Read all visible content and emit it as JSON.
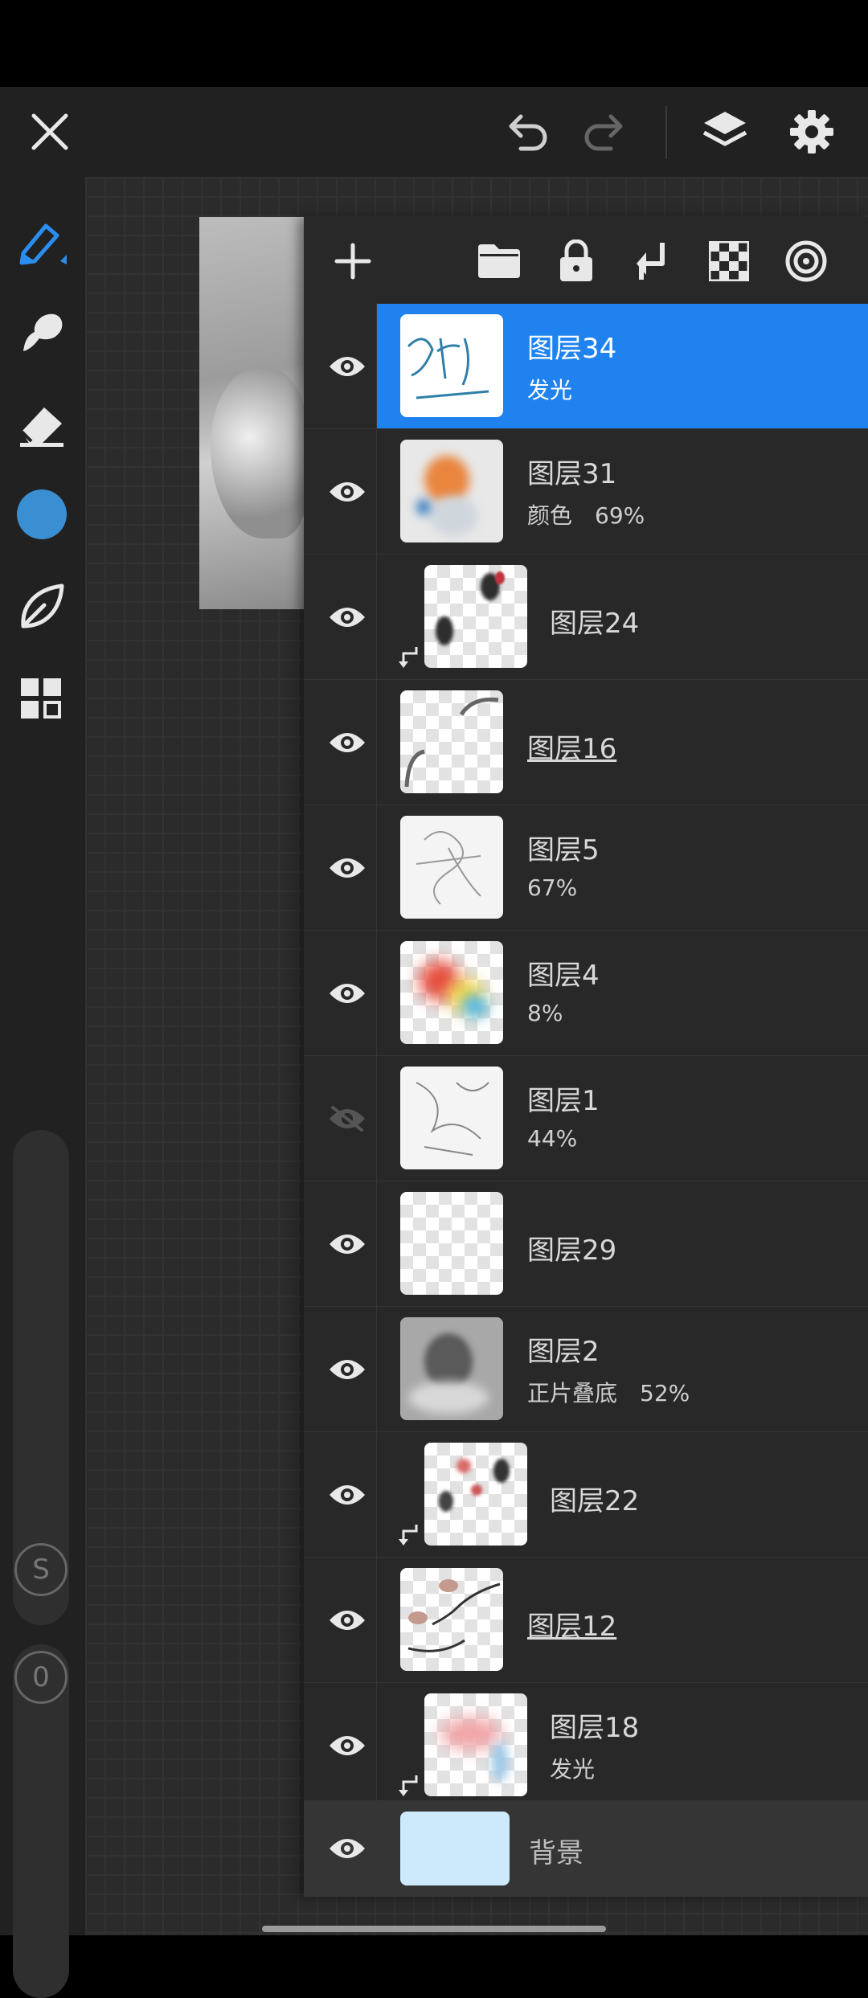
{
  "toolbar": {
    "icons": [
      "close-icon",
      "undo-icon",
      "redo-icon",
      "layers-icon",
      "settings-icon"
    ]
  },
  "tools": {
    "icons": [
      "pencil-icon",
      "smudge-icon",
      "eraser-icon",
      "color-icon",
      "leaf-icon",
      "grid-icon"
    ],
    "color": "#3a8fd3",
    "slider_top_label": "S",
    "slider_bottom_label": "0"
  },
  "layer_panel": {
    "toolbar_icons": [
      "add-layer-icon",
      "folder-icon",
      "lock-icon",
      "merge-down-icon",
      "alpha-checker-icon",
      "ring-target-icon"
    ],
    "accent": "#1f82ef",
    "layers": [
      {
        "name": "图层34",
        "sub": "发光",
        "selected": true,
        "clipped": false,
        "visible": true,
        "underline": false
      },
      {
        "name": "图层31",
        "sub": "颜色　69%",
        "selected": false,
        "clipped": false,
        "visible": true,
        "underline": false
      },
      {
        "name": "图层24",
        "sub": "",
        "selected": false,
        "clipped": true,
        "visible": true,
        "underline": false
      },
      {
        "name": "图层16",
        "sub": "",
        "selected": false,
        "clipped": false,
        "visible": true,
        "underline": true
      },
      {
        "name": "图层5",
        "sub": "67%",
        "selected": false,
        "clipped": false,
        "visible": true,
        "underline": false
      },
      {
        "name": "图层4",
        "sub": "8%",
        "selected": false,
        "clipped": false,
        "visible": true,
        "underline": false
      },
      {
        "name": "图层1",
        "sub": "44%",
        "selected": false,
        "clipped": false,
        "visible": false,
        "underline": false
      },
      {
        "name": "图层29",
        "sub": "",
        "selected": false,
        "clipped": false,
        "visible": true,
        "underline": false
      },
      {
        "name": "图层2",
        "sub": "正片叠底　52%",
        "selected": false,
        "clipped": false,
        "visible": true,
        "underline": false
      },
      {
        "name": "图层22",
        "sub": "",
        "selected": false,
        "clipped": true,
        "visible": true,
        "underline": false
      },
      {
        "name": "图层12",
        "sub": "",
        "selected": false,
        "clipped": false,
        "visible": true,
        "underline": true
      },
      {
        "name": "图层18",
        "sub": "发光",
        "selected": false,
        "clipped": true,
        "visible": true,
        "underline": false
      }
    ],
    "background": {
      "name": "背景",
      "color": "#cdeafc"
    }
  }
}
